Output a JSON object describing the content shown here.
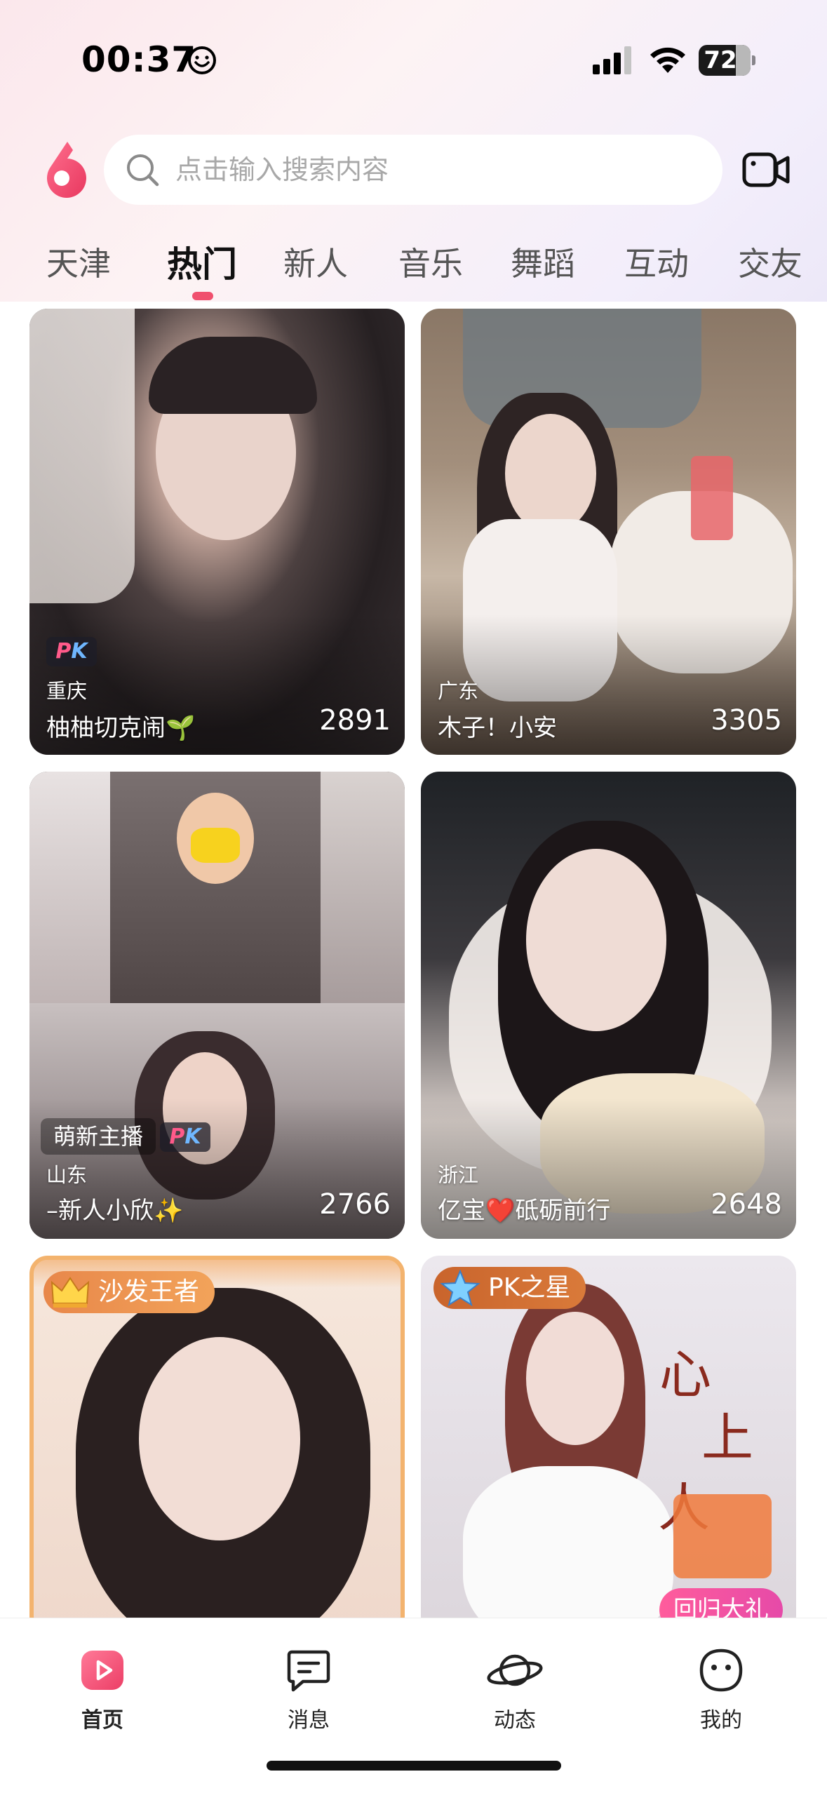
{
  "status_bar": {
    "time": "00:37",
    "battery_level": "72",
    "battery_fraction": 0.72,
    "icons": [
      "smiley-icon",
      "signal-icon",
      "wifi-icon",
      "battery-icon"
    ]
  },
  "header": {
    "logo_icon": "six-logo-icon",
    "search_placeholder": "点击输入搜索内容",
    "video_icon": "video-camera-icon"
  },
  "tabs": [
    {
      "label": "天津",
      "active": false
    },
    {
      "label": "热门",
      "active": true
    },
    {
      "label": "新人",
      "active": false
    },
    {
      "label": "音乐",
      "active": false
    },
    {
      "label": "舞蹈",
      "active": false
    },
    {
      "label": "互动",
      "active": false
    },
    {
      "label": "交友",
      "active": false
    }
  ],
  "colors": {
    "accent": "#f0506e",
    "rank_gold": "#f2a35a",
    "rank_blue": "#d97a3a"
  },
  "cards": [
    {
      "location": "重庆",
      "name": "柚柚切克闹🌱",
      "viewers": "2891",
      "pk_badge": "PK"
    },
    {
      "location": "广东",
      "name": "木子！小安",
      "viewers": "3305"
    },
    {
      "location": "山东",
      "name": "–新人小欣✨",
      "viewers": "2766",
      "tag": "萌新主播",
      "pk_badge": "PK"
    },
    {
      "location": "浙江",
      "name": "亿宝❤️砥砺前行",
      "viewers": "2648"
    },
    {
      "rank_badge": "沙发王者",
      "rank_icon": "crown-icon"
    },
    {
      "rank_badge": "PK之星",
      "rank_icon": "star-icon",
      "gift_tag": "回归大礼",
      "art_text_1": "心",
      "art_text_2": "上",
      "art_text_3": "人"
    }
  ],
  "tabbar": [
    {
      "label": "首页",
      "icon": "play-home-icon",
      "active": true
    },
    {
      "label": "消息",
      "icon": "message-icon",
      "active": false
    },
    {
      "label": "动态",
      "icon": "planet-icon",
      "active": false
    },
    {
      "label": "我的",
      "icon": "profile-face-icon",
      "active": false
    }
  ]
}
